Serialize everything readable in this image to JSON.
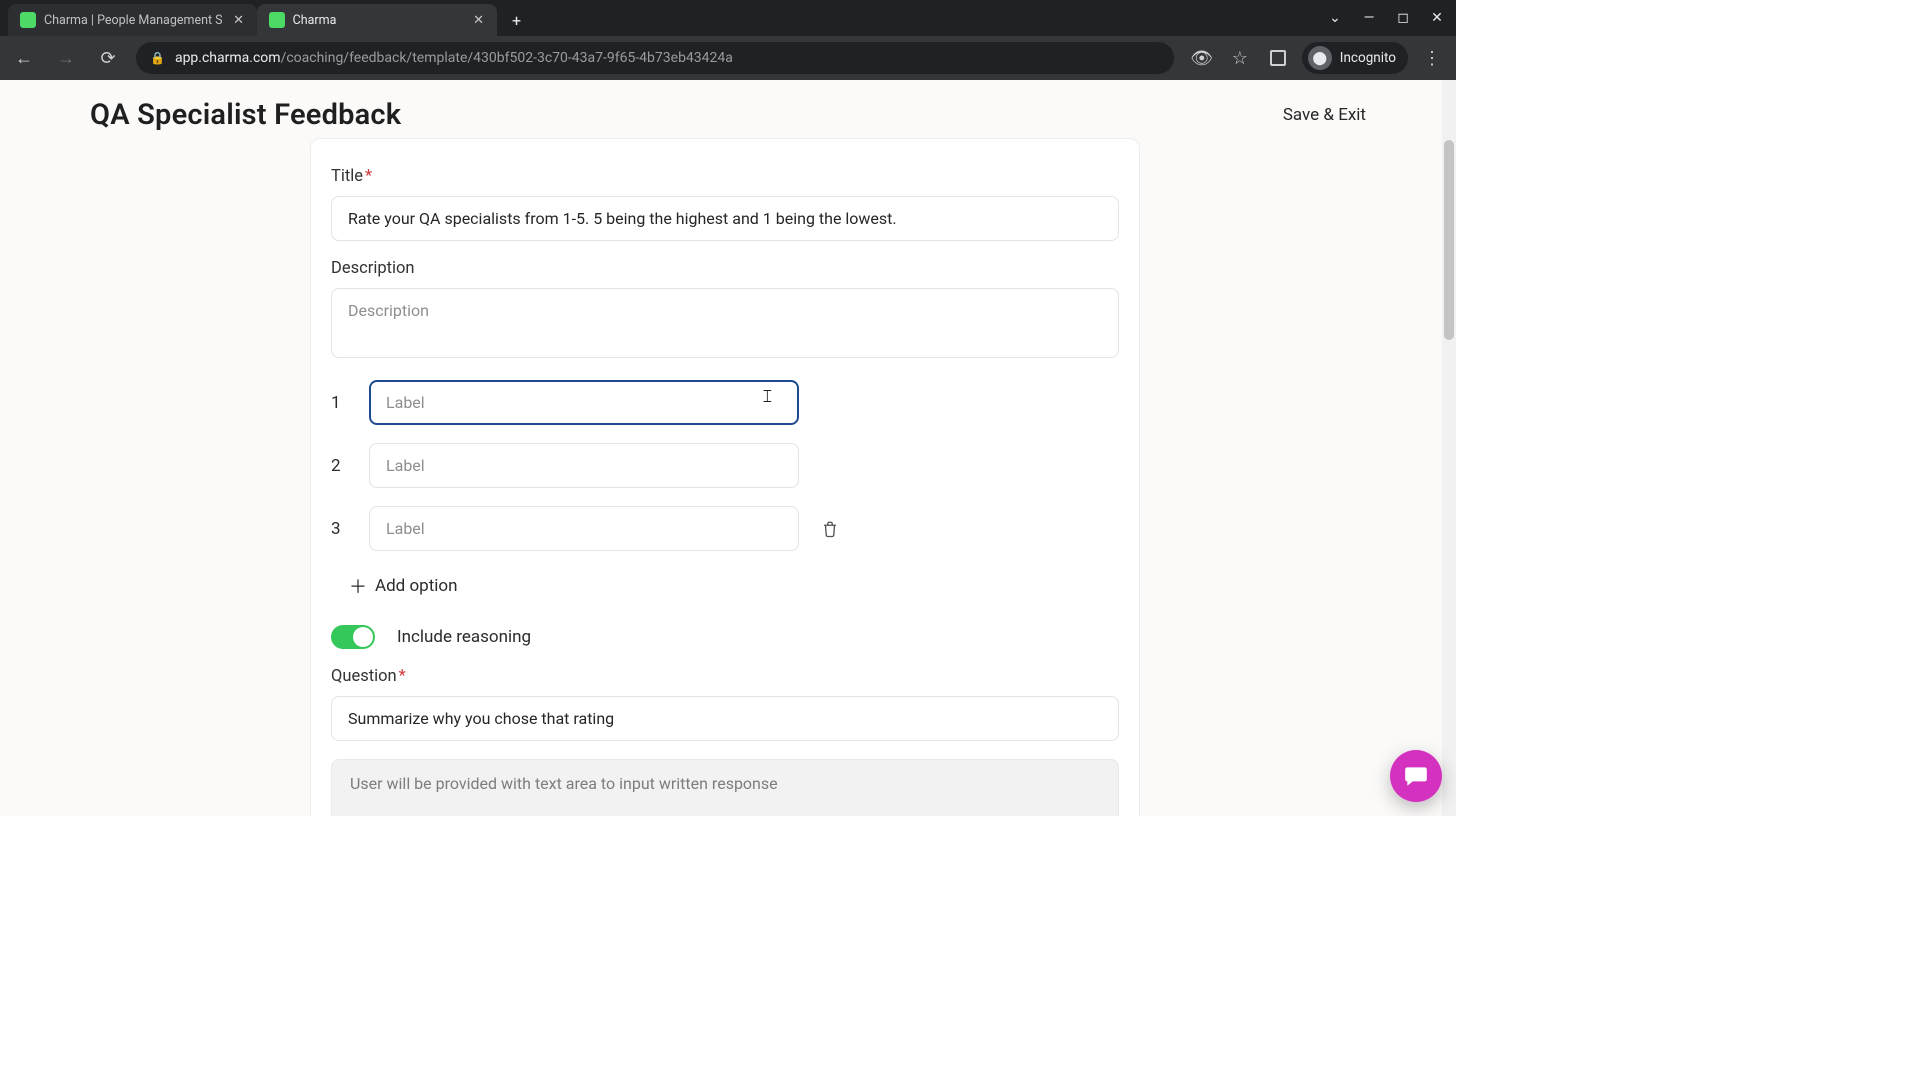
{
  "browser": {
    "tabs": [
      {
        "title": "Charma | People Management S",
        "active": false
      },
      {
        "title": "Charma",
        "active": true
      }
    ],
    "url_host": "app.charma.com",
    "url_path": "/coaching/feedback/template/430bf502-3c70-43a7-9f65-4b73eb43424a",
    "incognito_label": "Incognito"
  },
  "header": {
    "page_title": "QA Specialist Feedback",
    "save_exit": "Save & Exit"
  },
  "form": {
    "title_label": "Title",
    "title_value": "Rate your QA specialists from 1-5. 5 being the highest and 1 being the lowest.",
    "description_label": "Description",
    "description_placeholder": "Description",
    "options": [
      {
        "num": "1",
        "placeholder": "Label",
        "value": "",
        "focused": true,
        "deletable": false
      },
      {
        "num": "2",
        "placeholder": "Label",
        "value": "",
        "focused": false,
        "deletable": false
      },
      {
        "num": "3",
        "placeholder": "Label",
        "value": "",
        "focused": false,
        "deletable": true
      }
    ],
    "add_option": "Add option",
    "include_reasoning_label": "Include reasoning",
    "include_reasoning_on": true,
    "question_label": "Question",
    "question_value": "Summarize why you chose that rating",
    "readonly_hint": "User will be provided with text area to input written response"
  },
  "icons": {
    "tab_close": "✕",
    "new_tab": "+",
    "chevron_down": "⌄",
    "minimize": "—",
    "maximize": "◻",
    "close": "✕",
    "nav_back": "←",
    "nav_fwd": "→",
    "reload": "⟳",
    "lock": "🔒",
    "eye_off": "👁",
    "star": "☆",
    "ext_square": "",
    "kebab": "⋮",
    "plus": "＋",
    "trash": "🗑"
  }
}
